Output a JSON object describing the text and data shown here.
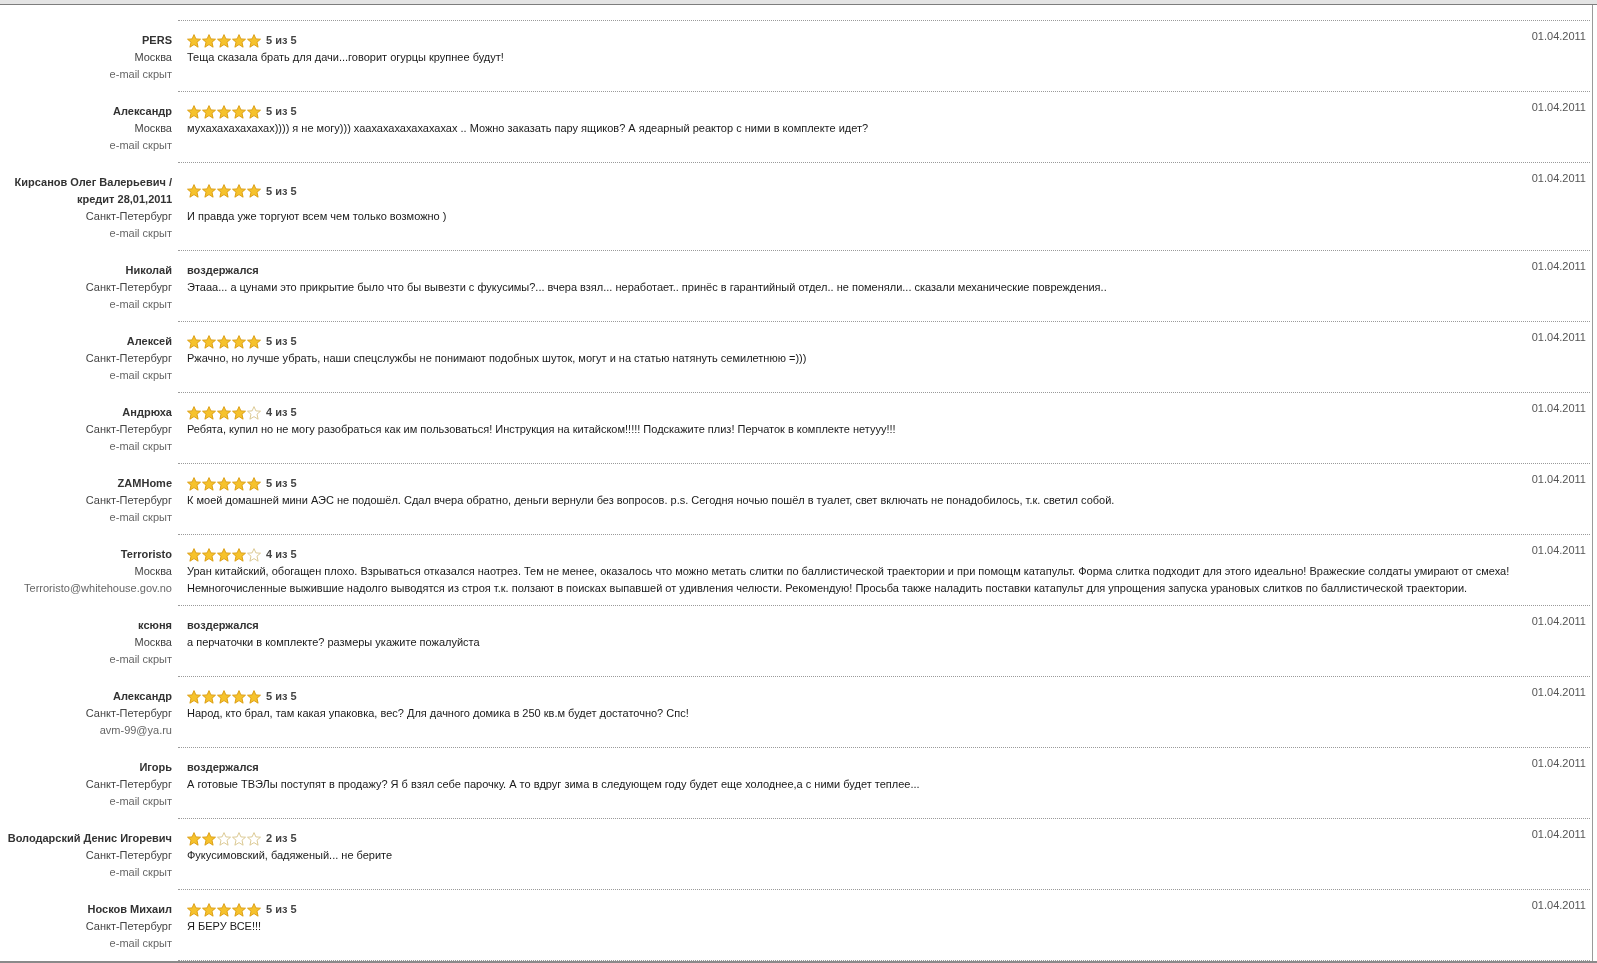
{
  "reviews": [
    {
      "name": "PERS",
      "city": "Москва",
      "email": "e-mail скрыт",
      "kind": "rating",
      "stars": 5,
      "score": "5 из 5",
      "text": "Теща сказала брать для дачи...говорит огурцы крупнее будут!",
      "date": "01.04.2011"
    },
    {
      "name": "Александр",
      "city": "Москва",
      "email": "e-mail скрыт",
      "kind": "rating",
      "stars": 5,
      "score": "5 из 5",
      "text": "мухахахахахахах)))) я не могу))) хаахахахахахахахах .. Можно заказать пару ящиков? А ядеарный реактор с ними в комплекте идет?",
      "date": "01.04.2011"
    },
    {
      "name": "Кирсанов Олег Валерьевич / кредит 28,01,2011",
      "city": "Санкт-Петербург",
      "email": "e-mail скрыт",
      "kind": "rating",
      "stars": 5,
      "score": "5 из 5",
      "text": "И правда уже торгуют всем чем только возможно )",
      "date": "01.04.2011"
    },
    {
      "name": "Николай",
      "city": "Санкт-Петербург",
      "email": "e-mail скрыт",
      "kind": "abstained",
      "verdict": "воздержался",
      "text": "Этааа... а цунами это прикрытие было что бы вывезти с фукусимы?... вчера взял... неработает.. принёс в гарантийный отдел.. не поменяли... сказали механические повреждения..",
      "date": "01.04.2011"
    },
    {
      "name": "Алексей",
      "city": "Санкт-Петербург",
      "email": "e-mail скрыт",
      "kind": "rating",
      "stars": 5,
      "score": "5 из 5",
      "text": "Ржачно, но лучше убрать, наши спецслужбы не понимают подобных шуток, могут и на статью натянуть семилетнюю =)))",
      "date": "01.04.2011"
    },
    {
      "name": "Андрюха",
      "city": "Санкт-Петербург",
      "email": "e-mail скрыт",
      "kind": "rating",
      "stars": 4,
      "score": "4 из 5",
      "text": "Ребята, купил но не могу разобраться как им пользоваться! Инструкция на китайском!!!!! Подскажите плиз! Перчаток в комплекте нетууу!!!",
      "date": "01.04.2011"
    },
    {
      "name": "ZAMHome",
      "city": "Санкт-Петербург",
      "email": "e-mail скрыт",
      "kind": "rating",
      "stars": 5,
      "score": "5 из 5",
      "text": "К моей домашней мини АЭС не подошёл. Сдал вчера обратно, деньги вернули без вопросов. p.s. Сегодня ночью пошёл в туалет, свет включать не понадобилось, т.к. светил собой.",
      "date": "01.04.2011"
    },
    {
      "name": "Terroristo",
      "city": "Москва",
      "email": "Terroristo@whitehouse.gov.no",
      "kind": "rating",
      "stars": 4,
      "score": "4 из 5",
      "text": "Уран китайский, обогащен плохо. Взрываться отказался наотрез. Тем не менее, оказалось что можно метать слитки по баллистической траектории и при помощм катапульт. Форма слитка подходит для этого идеально! Вражеские солдаты умирают от смеха! Немногочисленные выжившие надолго выводятся из строя т.к. ползают в поисках выпавшей от удивления челюсти. Рекомендую! Просьба также наладить поставки катапульт для упрощения запуска урановых слитков по баллистической траектории.",
      "date": "01.04.2011"
    },
    {
      "name": "ксюня",
      "city": "Москва",
      "email": "e-mail скрыт",
      "kind": "abstained",
      "verdict": "воздержался",
      "text": "а перчаточки в комплекте? размеры укажите пожалуйста",
      "date": "01.04.2011"
    },
    {
      "name": "Александр",
      "city": "Санкт-Петербург",
      "email": "avm-99@ya.ru",
      "kind": "rating",
      "stars": 5,
      "score": "5 из 5",
      "text": "Народ, кто брал, там какая упаковка, вес? Для дачного домика в 250 кв.м будет достаточно? Спс!",
      "date": "01.04.2011"
    },
    {
      "name": "Игорь",
      "city": "Санкт-Петербург",
      "email": "e-mail скрыт",
      "kind": "abstained",
      "verdict": "воздержался",
      "text": "А готовые ТВЭЛы поступят в продажу? Я б взял себе парочку. А то вдруг зима в следующем году будет еще холоднее,а с ними будет теплее...",
      "date": "01.04.2011"
    },
    {
      "name": "Володарский Денис Игоревич",
      "city": "Санкт-Петербург",
      "email": "e-mail скрыт",
      "kind": "rating",
      "stars": 2,
      "score": "2 из 5",
      "text": "Фукусимовский, бадяженый... не берите",
      "date": "01.04.2011"
    },
    {
      "name": "Носков Михаил",
      "city": "Санкт-Петербург",
      "email": "e-mail скрыт",
      "kind": "rating",
      "stars": 5,
      "score": "5 из 5",
      "text": "Я БЕРУ ВСЕ!!!",
      "date": "01.04.2011"
    }
  ]
}
